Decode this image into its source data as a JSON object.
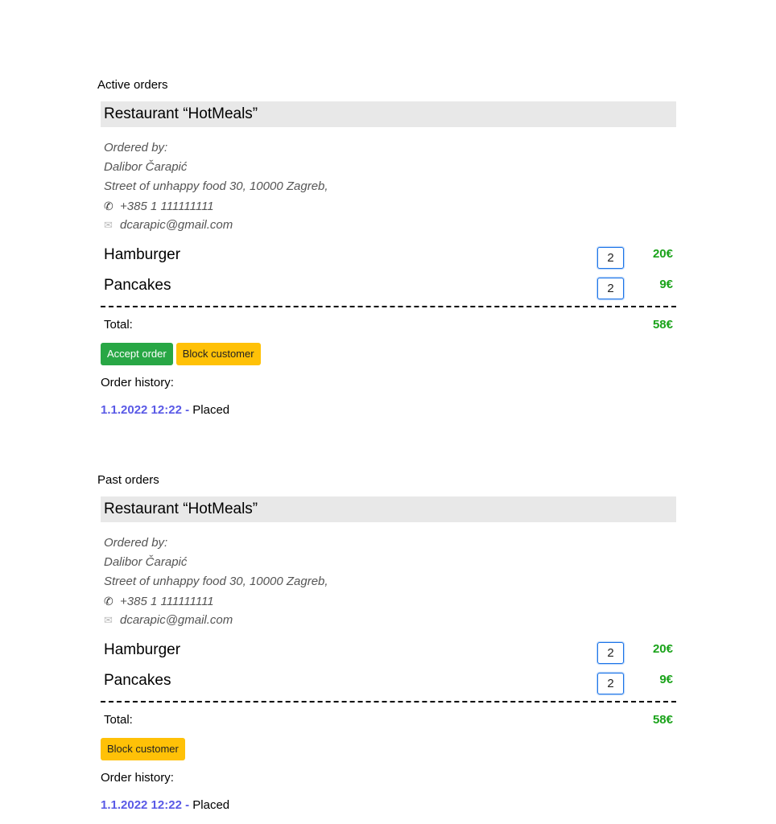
{
  "active": {
    "section_title": "Active orders",
    "restaurant": "Restaurant “HotMeals”",
    "customer": {
      "ordered_by_label": "Ordered by:",
      "name": "Dalibor Čarapić",
      "address": "Street of unhappy food 30, 10000 Zagreb,",
      "phone_icon": "phone-icon",
      "phone": "+385 1 111111111",
      "email_icon": "envelope-icon",
      "email": "dcarapic@gmail.com"
    },
    "items": [
      {
        "name": "Hamburger",
        "qty": "2",
        "price": "20€"
      },
      {
        "name": "Pancakes",
        "qty": "2",
        "price": "9€"
      }
    ],
    "total_label": "Total:",
    "total_value": "58€",
    "accept_button": "Accept order",
    "block_button": "Block customer",
    "history_title": "Order history:",
    "history": [
      {
        "date": "1.1.2022 12:22",
        "separator": " - ",
        "status": "Placed"
      }
    ]
  },
  "past": {
    "section_title": "Past orders",
    "restaurant": "Restaurant “HotMeals”",
    "customer": {
      "ordered_by_label": "Ordered by:",
      "name": "Dalibor Čarapić",
      "address": "Street of unhappy food 30, 10000 Zagreb,",
      "phone_icon": "phone-icon",
      "phone": "+385 1 111111111",
      "email_icon": "envelope-icon",
      "email": "dcarapic@gmail.com"
    },
    "items": [
      {
        "name": "Hamburger",
        "qty": "2",
        "price": "20€"
      },
      {
        "name": "Pancakes",
        "qty": "2",
        "price": "9€"
      }
    ],
    "total_label": "Total:",
    "total_value": "58€",
    "block_button": "Block customer",
    "history_title": "Order history:",
    "history": [
      {
        "date": "1.1.2022 12:22",
        "separator": " - ",
        "status": "Placed"
      }
    ]
  },
  "colors": {
    "price_green": "#1aa31a",
    "accept_green": "#28a745",
    "block_yellow": "#ffc107",
    "history_date_purple": "#5a5ae6",
    "header_gray": "#e8e8e8",
    "qty_border_blue": "#1a73e8"
  }
}
